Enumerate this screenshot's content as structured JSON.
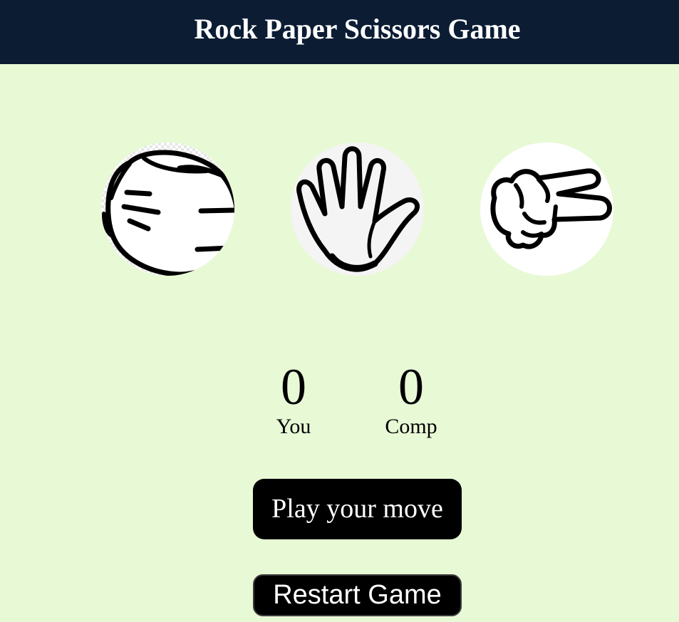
{
  "header": {
    "title": "Rock Paper Scissors Game"
  },
  "choices": [
    {
      "id": "rock",
      "icon": "rock-fist-icon"
    },
    {
      "id": "paper",
      "icon": "paper-hand-icon"
    },
    {
      "id": "scissors",
      "icon": "scissors-hand-icon"
    }
  ],
  "score": {
    "user_value": "0",
    "user_label": "You",
    "comp_value": "0",
    "comp_label": "Comp"
  },
  "message": "Play your move",
  "restart_label": "Restart Game",
  "colors": {
    "header_bg": "#0b1c33",
    "page_bg": "#e8f9d6",
    "button_bg": "#000000",
    "button_text": "#ffffff"
  }
}
